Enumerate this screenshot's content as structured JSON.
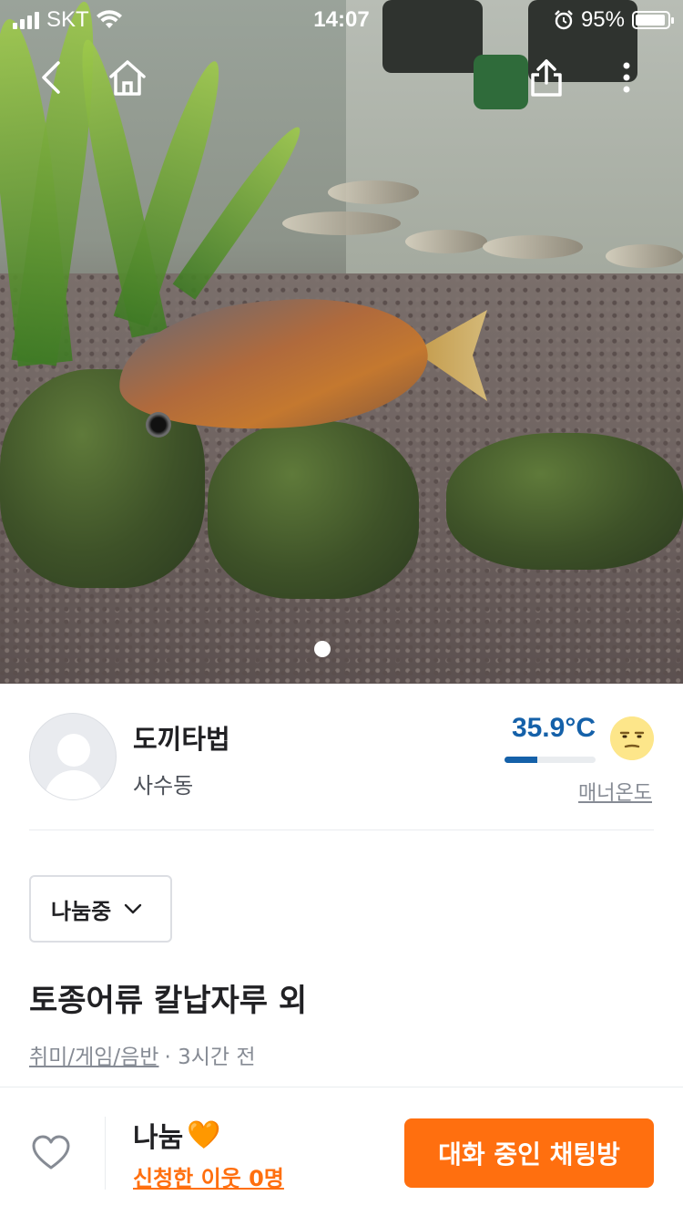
{
  "status_bar": {
    "carrier": "SKT",
    "time": "14:07",
    "battery_percent": "95%",
    "battery_level": 0.95
  },
  "nav": {
    "icons": [
      "back-icon",
      "home-icon",
      "share-icon",
      "more-vertical-icon"
    ]
  },
  "gallery": {
    "page_count": 1,
    "current_page": 1
  },
  "seller": {
    "nickname": "도끼타법",
    "region": "사수동",
    "manner_temperature": "35.9°C",
    "manner_temperature_value": 35.9,
    "manner_label": "매너온도",
    "face_icon": "unamused-face-icon"
  },
  "post": {
    "status_select": "나눔중",
    "title": "토종어류 칼납자루 외",
    "category": "취미/게임/음반",
    "time_ago": "· 3시간 전"
  },
  "footer": {
    "price": "나눔",
    "price_emoji": "🧡",
    "applicants": "신청한 이웃 0명",
    "chat_button": "대화 중인 채팅방"
  },
  "colors": {
    "accent": "#ff6f0f",
    "temperature": "#1561a9"
  }
}
